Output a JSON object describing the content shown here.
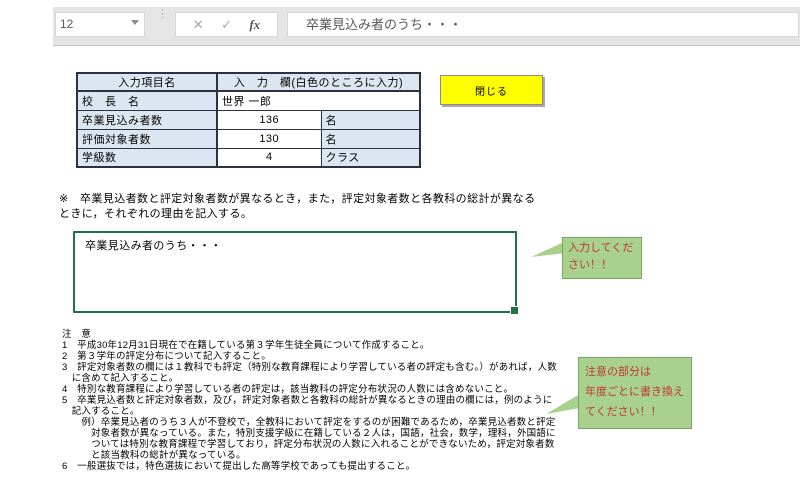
{
  "formula_bar": {
    "name_box_value": "12",
    "cancel_icon": "✕",
    "enter_icon": "✓",
    "fx_icon": "fx",
    "formula_text": "卒業見込み者のうち・・・"
  },
  "input_table": {
    "header": {
      "col1": "入力項目名",
      "col2": "入　力　欄(白色のところに入力)"
    },
    "rows": [
      {
        "label": "校　長　名",
        "value": "世界 一郎",
        "unit": ""
      },
      {
        "label": "卒業見込み者数",
        "value": "136",
        "unit": "名"
      },
      {
        "label": "評価対象者数",
        "value": "130",
        "unit": "名"
      },
      {
        "label": "学級数",
        "value": "4",
        "unit": "クラス"
      }
    ]
  },
  "close_button": {
    "label": "閉じる"
  },
  "instruction": {
    "text": "※　卒業見込者数と評定対象者数が異なるとき，また，評定対象者数と各教科の総計が異なる\nときに，それぞれの理由を記入する。"
  },
  "reason_box": {
    "text": "卒業見込み者のうち・・・"
  },
  "callouts": [
    {
      "text": "入力してくだ\nさい！！"
    },
    {
      "text": "注意の部分は\n年度ごとに書き換え\nてください！！"
    }
  ],
  "notes": {
    "lines": [
      "注　意",
      "1　平成30年12月31日現在で在籍している第３学年生徒全員について作成すること。",
      "2　第３学年の評定分布について記入すること。",
      "3　評定対象者数の欄には１教科でも評定（特別な教育課程により学習している者の評定も含む。）があれば，人数",
      "　に含めて記入すること。",
      "4　特別な教育課程により学習している者の評定は，該当教科の評定分布状況の人数には含めないこと。",
      "5　卒業見込者数と評定対象者数，及び，評定対象者数と各教科の総計が異なるときの理由の欄には，例のように",
      "　記入すること。",
      "　　例）卒業見込者のうち３人が不登校で，全教科において評定をするのが困難であるため，卒業見込者数と評定",
      "　　　対象者数が異なっている。また，特別支援学級に在籍している２人は，国語，社会，数学，理科，外国語に",
      "　　　ついては特別な教育課程で学習しており，評定分布状況の人数に入れることができないため，評定対象者数",
      "　　　と該当教科の総計が異なっている。",
      "6　一般選抜では，特色選抜において提出した高等学校であっても提出すること。"
    ]
  },
  "colors": {
    "button_yellow": "#ffff00",
    "table_header_blue": "#dce6f1",
    "selection_green": "#217346",
    "callout_fill": "#a9d18e",
    "callout_border": "#76a85b",
    "callout_text": "#c0392b"
  }
}
